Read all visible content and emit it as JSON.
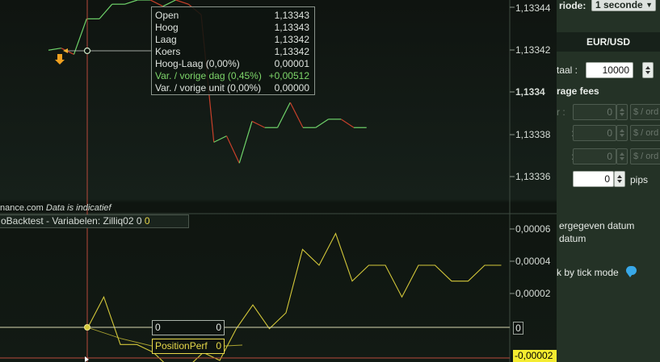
{
  "price_axis": {
    "labels": [
      "1,13344",
      "1,13342",
      "1,1334",
      "1,13338",
      "1,13336"
    ],
    "bold_label": "1,1334"
  },
  "indicator_axis": {
    "labels": [
      "0,00006",
      "0,00004",
      "0,00002"
    ],
    "zero_marker": "0",
    "negative_marker": "-0,00002"
  },
  "tooltip": {
    "rows": [
      {
        "label": "Open",
        "value": "1,13343"
      },
      {
        "label": "Hoog",
        "value": "1,13343"
      },
      {
        "label": "Laag",
        "value": "1,13342"
      },
      {
        "label": "Koers",
        "value": "1,13342"
      },
      {
        "label": "Hoog-Laag (0,00%)",
        "value": "0,00001"
      },
      {
        "label": "Var. / vorige dag (0,45%)",
        "value": "+0,00512"
      },
      {
        "label": "Var. / vorige unit (0,00%)",
        "value": "0,00000"
      }
    ]
  },
  "source": {
    "text": "nance.com",
    "note": "Data is indicatief"
  },
  "panel_legend": {
    "text": "oBacktest - Variabelen: Zilliq02",
    "value_white": "0",
    "value_yellow": "0"
  },
  "crosshair_boxes": {
    "zero_left": "0",
    "zero_right": "0",
    "series_name": "PositionPerf",
    "series_value": "0"
  },
  "right_panel": {
    "period_label": "riode:",
    "period_value": "1 seconde",
    "pair": "EUR/USD",
    "qty_label": "taal :",
    "qty_value": "10000",
    "fees_label": "rage fees",
    "fee_rows": [
      {
        "label": "r :",
        "value": "0",
        "unit": "$ / ord"
      },
      {
        "label": ":",
        "value": "0",
        "unit": "$ / ord"
      },
      {
        "label": ":",
        "value": "0",
        "unit": "$ / ord"
      }
    ],
    "pips_value": "0",
    "pips_label": "pips",
    "date_line1": "ergegeven datum",
    "date_line2": "datum",
    "tick_mode": "k by tick mode"
  },
  "colors": {
    "up": "#6fd36a",
    "down": "#c8402a",
    "indicator": "#d4c83a",
    "crosshair": "#b84a3c"
  },
  "chart_data": {
    "type": "line",
    "price_series": {
      "name": "",
      "y": [
        1.133422,
        1.133423,
        1.13342,
        1.133437,
        1.133437,
        1.133444,
        1.133444,
        1.133446,
        1.133446,
        1.133443,
        1.133446,
        1.133444,
        1.133439,
        1.133378,
        1.133381,
        1.133368,
        1.133388,
        1.133385,
        1.133385,
        1.133397,
        1.133385,
        1.133385,
        1.133389,
        1.133389,
        1.133385,
        1.133385
      ],
      "ylim": [
        1.133345,
        1.133446
      ]
    },
    "indicator_series": {
      "name": "PositionPerf",
      "y": [
        0,
        2e-05,
        -1e-05,
        -1e-05,
        -1.5e-05,
        -2.5e-05,
        -2.5e-05,
        -1.5e-05,
        -2e-05,
        0.0,
        1.5e-05,
        0.0,
        1e-05,
        5e-05,
        4e-05,
        6e-05,
        3e-05,
        4e-05,
        4e-05,
        2e-05,
        4e-05,
        4e-05,
        3e-05,
        3e-05,
        4e-05,
        4e-05
      ],
      "ylim": [
        -2e-05,
        7e-05
      ]
    }
  }
}
